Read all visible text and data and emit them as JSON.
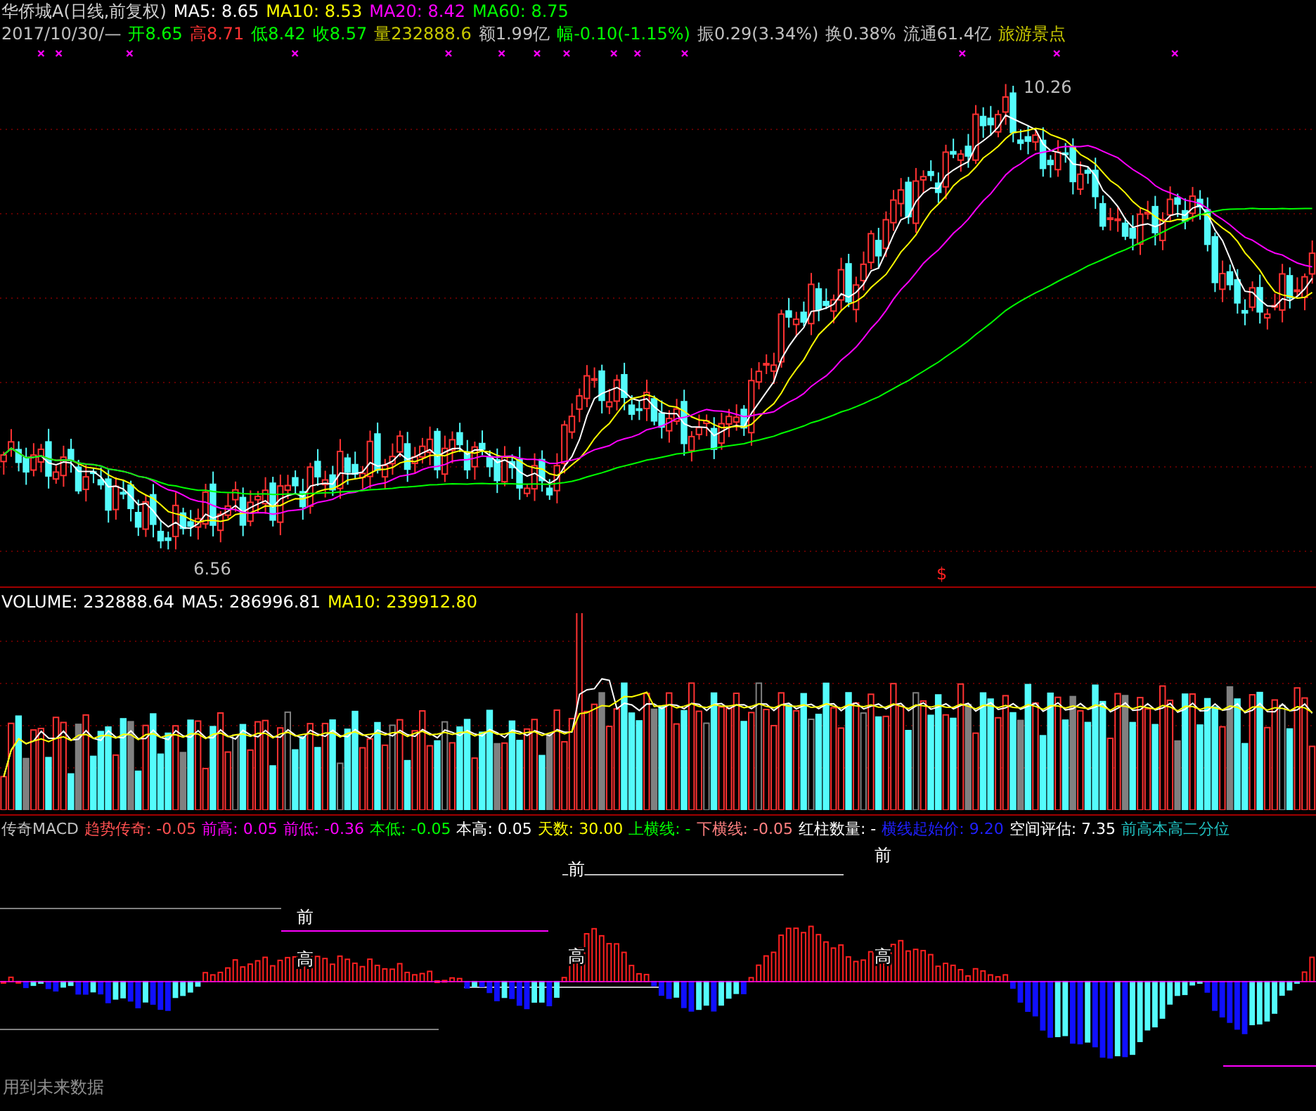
{
  "header": {
    "line_1": [
      {
        "text": "华侨城A(日线,前复权)",
        "color": "#d0d0d0"
      },
      {
        "text": "MA5: 8.65",
        "color": "#ffffff"
      },
      {
        "text": "MA10: 8.53",
        "color": "#ffff00"
      },
      {
        "text": "MA20: 8.42",
        "color": "#ff00ff"
      },
      {
        "text": "MA60: 8.75",
        "color": "#00ff00"
      }
    ],
    "line_2": [
      {
        "text": "2017/10/30/—",
        "color": "#c0c0c0"
      },
      {
        "text": "开8.65",
        "color": "#00ff00"
      },
      {
        "text": "高8.71",
        "color": "#ff3232"
      },
      {
        "text": "低8.42",
        "color": "#00ff00"
      },
      {
        "text": "收8.57",
        "color": "#00ff00"
      },
      {
        "text": "量232888.6",
        "color": "#c8c800"
      },
      {
        "text": "额1.99亿",
        "color": "#c0c0c0"
      },
      {
        "text": "幅-0.10(-1.15%)",
        "color": "#00ff00"
      },
      {
        "text": "振0.29(3.34%)",
        "color": "#c0c0c0"
      },
      {
        "text": "换0.38%",
        "color": "#c0c0c0"
      },
      {
        "text": "流通61.4亿",
        "color": "#c0c0c0"
      },
      {
        "text": "旅游景点",
        "color": "#c8c800"
      }
    ]
  },
  "price_chart": {
    "high_label": "10.26",
    "low_label": "6.56",
    "signal_mark": "$"
  },
  "volume_panel": {
    "legend": [
      {
        "text": "VOLUME: 232888.64",
        "color": "#ffffff"
      },
      {
        "text": "MA5: 286996.81",
        "color": "#ffffff"
      },
      {
        "text": "MA10: 239912.80",
        "color": "#ffff00"
      }
    ]
  },
  "macd_panel": {
    "legend": [
      {
        "text": "传奇MACD",
        "color": "#c0c0c0"
      },
      {
        "text": "趋势传奇: -0.05",
        "color": "#ff5050"
      },
      {
        "text": "前高: 0.05",
        "color": "#ff00ff"
      },
      {
        "text": "前低: -0.36",
        "color": "#ff00ff"
      },
      {
        "text": "本低: -0.05",
        "color": "#00ff00"
      },
      {
        "text": "本高: 0.05",
        "color": "#ffffff"
      },
      {
        "text": "天数: 30.00",
        "color": "#ffff00"
      },
      {
        "text": "上横线: -",
        "color": "#00ff00"
      },
      {
        "text": "下横线: -0.05",
        "color": "#ff8080"
      },
      {
        "text": "红柱数量: -",
        "color": "#ffffff"
      },
      {
        "text": "横线起始价: 9.20",
        "color": "#2020ff"
      },
      {
        "text": "空间评估: 7.35",
        "color": "#ffffff"
      },
      {
        "text": "前高本高二分位",
        "color": "#20c0c0"
      }
    ],
    "labels": [
      "前",
      "高",
      "前",
      "高",
      "前",
      "高"
    ],
    "footer": "用到未来数据"
  }
}
